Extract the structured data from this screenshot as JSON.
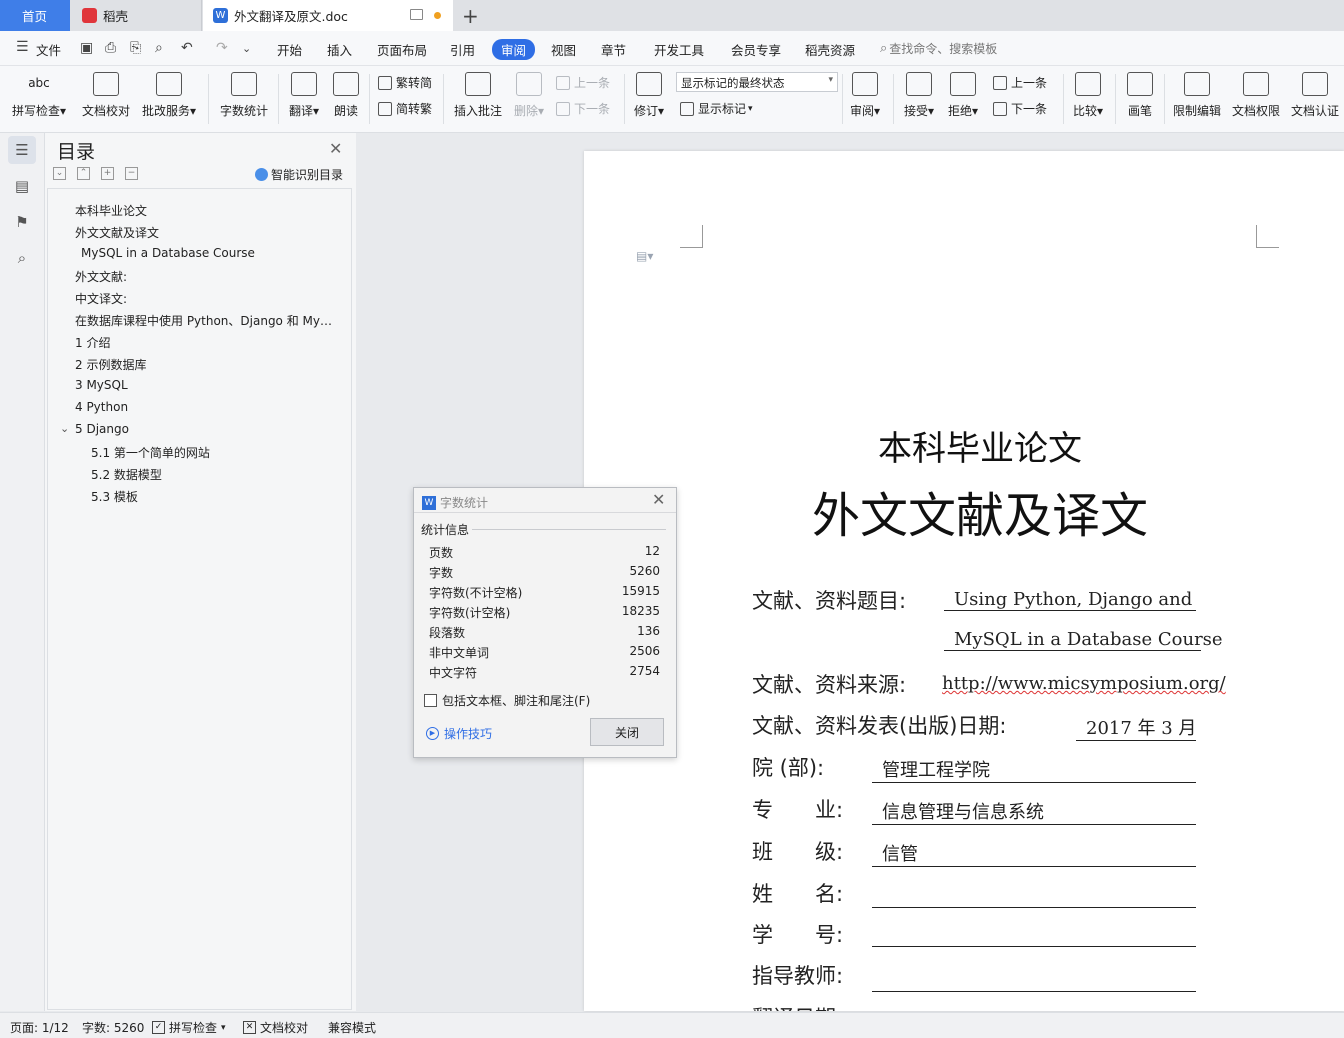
{
  "tabs": {
    "home": "首页",
    "daoke": "稻壳",
    "document": "外文翻译及原文.doc",
    "add": "+"
  },
  "menu": {
    "file": "文件",
    "items": [
      "开始",
      "插入",
      "页面布局",
      "引用",
      "审阅",
      "视图",
      "章节",
      "开发工具",
      "会员专享",
      "稻壳资源"
    ],
    "active": "审阅",
    "search_placeholder": "查找命令、搜索模板"
  },
  "ribbon": {
    "spell_check": "拼写检查",
    "doc_check": "文档校对",
    "grading": "批改服务",
    "word_count": "字数统计",
    "translate": "翻译",
    "read_aloud": "朗读",
    "trad_to_simp": "繁转简",
    "simp_to_trad": "简转繁",
    "insert_comment": "插入批注",
    "delete": "删除",
    "prev_comment": "上一条",
    "next_comment": "下一条",
    "revise": "修订",
    "markup_state": "显示标记的最终状态",
    "show_markup": "显示标记",
    "review": "审阅",
    "accept": "接受",
    "reject": "拒绝",
    "prev_change": "上一条",
    "next_change": "下一条",
    "compare": "比较",
    "pen": "画笔",
    "restrict_edit": "限制编辑",
    "doc_permission": "文档权限",
    "doc_auth": "文档认证"
  },
  "toc": {
    "title": "目录",
    "smart": "智能识别目录",
    "items": [
      "本科毕业论文",
      "外文文献及译文",
      "MySQL in a Database Course",
      "外文文献:",
      "中文译文:",
      "在数据库课程中使用 Python、Django 和 My…",
      "1 介绍",
      "2 示例数据库",
      "3 MySQL",
      "4 Python",
      "5 Django",
      "5.1 第一个简单的网站",
      "5.2 数据模型",
      "5.3 模板"
    ]
  },
  "document": {
    "heading1": "本科毕业论文",
    "heading2": "外文文献及译文",
    "fields": [
      {
        "label": "文献、资料题目:",
        "value": "Using Python, Django and"
      },
      {
        "label": "",
        "value": "MySQL in a Database Course"
      },
      {
        "label": "文献、资料来源:",
        "value": "http://www.micsymposium.org/"
      },
      {
        "label": "文献、资料发表(出版)日期:",
        "value": "2017 年 3 月"
      },
      {
        "label": "院 (部):",
        "value": "管理工程学院"
      },
      {
        "label": "专　　业:",
        "value": "信息管理与信息系统"
      },
      {
        "label": "班　　级:",
        "value": "信管"
      },
      {
        "label": "姓　　名:",
        "value": ""
      },
      {
        "label": "学　　号:",
        "value": ""
      },
      {
        "label": "指导教师:",
        "value": ""
      },
      {
        "label": "翻译日期",
        "value": ""
      }
    ]
  },
  "dialog": {
    "title": "字数统计",
    "section": "统计信息",
    "stats": [
      {
        "label": "页数",
        "value": "12"
      },
      {
        "label": "字数",
        "value": "5260"
      },
      {
        "label": "字符数(不计空格)",
        "value": "15915"
      },
      {
        "label": "字符数(计空格)",
        "value": "18235"
      },
      {
        "label": "段落数",
        "value": "136"
      },
      {
        "label": "非中文单词",
        "value": "2506"
      },
      {
        "label": "中文字符",
        "value": "2754"
      }
    ],
    "include_label": "包括文本框、脚注和尾注(F)",
    "tips": "操作技巧",
    "close": "关闭"
  },
  "status": {
    "page": "页面: 1/12",
    "words": "字数: 5260",
    "spell": "拼写检查",
    "doc_check": "文档校对",
    "compat": "兼容模式"
  },
  "colors": {
    "accent": "#2f6ee5",
    "home_tab": "#3f7ee8",
    "daoke_icon": "#e0353b",
    "wps_blue": "#2e6fd8",
    "modified_dot": "#f0a020"
  }
}
